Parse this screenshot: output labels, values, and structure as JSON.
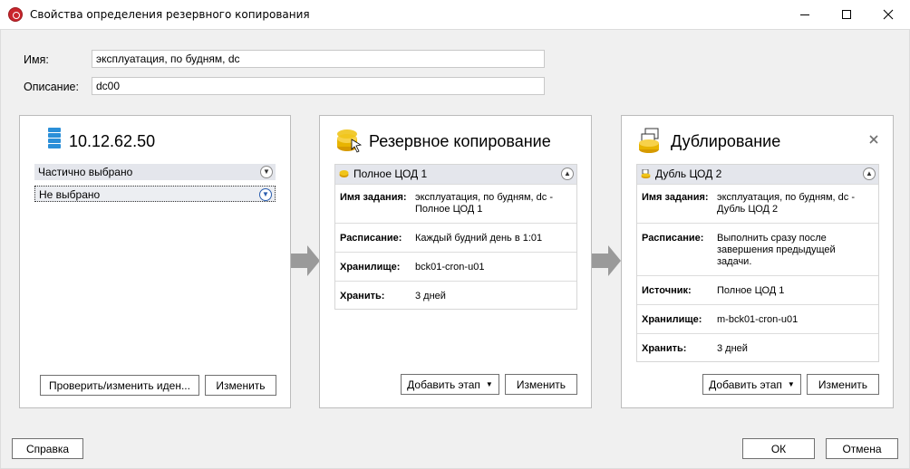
{
  "window": {
    "title": "Свойства определения резервного копирования"
  },
  "form": {
    "name_label": "Имя:",
    "name_value": "эксплуатация, по будням, dc",
    "description_label": "Описание:",
    "description_value": "dc00"
  },
  "source_panel": {
    "title": "10.12.62.50",
    "rows": [
      {
        "label": "Частично выбрано"
      },
      {
        "label": "Не выбрано"
      }
    ],
    "verify_button": "Проверить/изменить иден...",
    "edit_button": "Изменить"
  },
  "backup_panel": {
    "title": "Резервное копирование",
    "stage_title": "Полное ЦОД 1",
    "rows": [
      {
        "key": "Имя задания:",
        "value": "эксплуатация, по будням, dc - Полное ЦОД 1"
      },
      {
        "key": "Расписание:",
        "value": "Каждый будний день в 1:01"
      },
      {
        "key": "Хранилище:",
        "value": "bck01-cron-u01"
      },
      {
        "key": "Хранить:",
        "value": "3 дней"
      }
    ],
    "add_stage_button": "Добавить этап",
    "edit_button": "Изменить"
  },
  "duplicate_panel": {
    "title": "Дублирование",
    "stage_title": "Дубль ЦОД 2",
    "rows": [
      {
        "key": "Имя задания:",
        "value": "эксплуатация, по будням, dc - Дубль ЦОД 2"
      },
      {
        "key": "Расписание:",
        "value": "Выполнить сразу после завершения предыдущей задачи."
      },
      {
        "key": "Источник:",
        "value": "Полное ЦОД 1"
      },
      {
        "key": "Хранилище:",
        "value": "m-bck01-cron-u01"
      },
      {
        "key": "Хранить:",
        "value": "3 дней"
      }
    ],
    "add_stage_button": "Добавить этап",
    "edit_button": "Изменить"
  },
  "footer": {
    "help_button": "Справка",
    "ok_button": "ОК",
    "cancel_button": "Отмена"
  },
  "colors": {
    "accent": "#2a5dae",
    "arrow": "#9a9a9a",
    "row_header": "#e4e6ec"
  }
}
